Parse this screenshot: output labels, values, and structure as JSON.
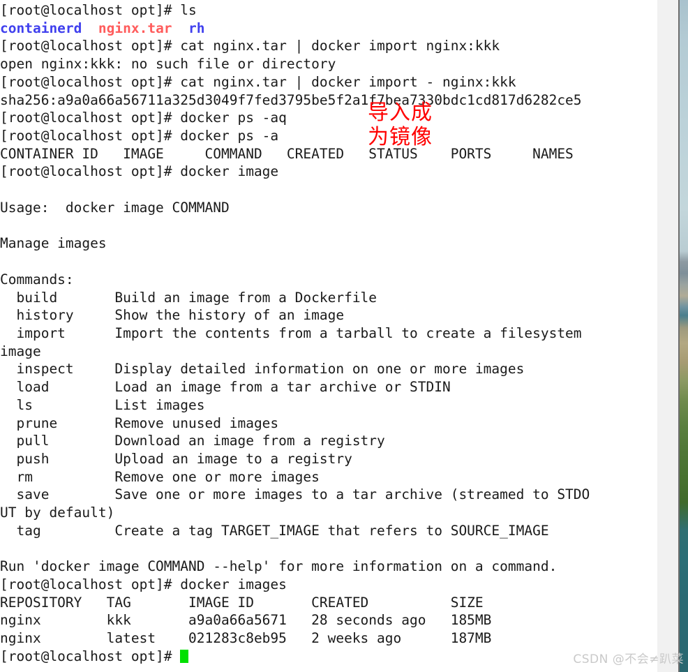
{
  "window": {
    "title": "root@localhost:/opt terminal",
    "prompt": "[root@localhost opt]#"
  },
  "terminal": {
    "font_color": "#1a1a1a",
    "background": "#ffffff",
    "cursor_color": "#00e000",
    "dir_color": "#4040ee",
    "archive_color": "#ff5c5c",
    "lines": [
      {
        "id": "l01",
        "type": "prompt",
        "prompt": "[root@localhost opt]# ",
        "command": "ls"
      },
      {
        "id": "l02",
        "type": "ls-out",
        "segments": [
          {
            "text": "containerd",
            "color": "blue"
          },
          {
            "text": "  ",
            "color": "normal"
          },
          {
            "text": "nginx.tar",
            "color": "red"
          },
          {
            "text": "  ",
            "color": "normal"
          },
          {
            "text": "rh",
            "color": "blue"
          }
        ]
      },
      {
        "id": "l03",
        "type": "prompt",
        "prompt": "[root@localhost opt]# ",
        "command": "cat nginx.tar | docker import nginx:kkk"
      },
      {
        "id": "l04",
        "type": "output",
        "text": "open nginx:kkk: no such file or directory"
      },
      {
        "id": "l05",
        "type": "prompt",
        "prompt": "[root@localhost opt]# ",
        "command": "cat nginx.tar | docker import - nginx:kkk"
      },
      {
        "id": "l06",
        "type": "output",
        "text": "sha256:a9a0a66a56711a325d3049f7fed3795be5f2a1f7bea7330bdc1cd817d6282ce5"
      },
      {
        "id": "l07",
        "type": "prompt",
        "prompt": "[root@localhost opt]# ",
        "command": "docker ps -aq"
      },
      {
        "id": "l08",
        "type": "prompt",
        "prompt": "[root@localhost opt]# ",
        "command": "docker ps -a"
      },
      {
        "id": "l09",
        "type": "output",
        "text": "CONTAINER ID   IMAGE     COMMAND   CREATED   STATUS    PORTS     NAMES"
      },
      {
        "id": "l10",
        "type": "prompt",
        "prompt": "[root@localhost opt]# ",
        "command": "docker image"
      },
      {
        "id": "l11",
        "type": "output",
        "text": ""
      },
      {
        "id": "l12",
        "type": "output",
        "text": "Usage:  docker image COMMAND"
      },
      {
        "id": "l13",
        "type": "output",
        "text": ""
      },
      {
        "id": "l14",
        "type": "output",
        "text": "Manage images"
      },
      {
        "id": "l15",
        "type": "output",
        "text": ""
      },
      {
        "id": "l16",
        "type": "output",
        "text": "Commands:"
      },
      {
        "id": "l17",
        "type": "output",
        "text": "  build       Build an image from a Dockerfile"
      },
      {
        "id": "l18",
        "type": "output",
        "text": "  history     Show the history of an image"
      },
      {
        "id": "l19",
        "type": "output",
        "text": "  import      Import the contents from a tarball to create a filesystem"
      },
      {
        "id": "l20",
        "type": "output",
        "text": "image"
      },
      {
        "id": "l21",
        "type": "output",
        "text": "  inspect     Display detailed information on one or more images"
      },
      {
        "id": "l22",
        "type": "output",
        "text": "  load        Load an image from a tar archive or STDIN"
      },
      {
        "id": "l23",
        "type": "output",
        "text": "  ls          List images"
      },
      {
        "id": "l24",
        "type": "output",
        "text": "  prune       Remove unused images"
      },
      {
        "id": "l25",
        "type": "output",
        "text": "  pull        Download an image from a registry"
      },
      {
        "id": "l26",
        "type": "output",
        "text": "  push        Upload an image to a registry"
      },
      {
        "id": "l27",
        "type": "output",
        "text": "  rm          Remove one or more images"
      },
      {
        "id": "l28",
        "type": "output",
        "text": "  save        Save one or more images to a tar archive (streamed to STDO"
      },
      {
        "id": "l29",
        "type": "output",
        "text": "UT by default)"
      },
      {
        "id": "l30",
        "type": "output",
        "text": "  tag         Create a tag TARGET_IMAGE that refers to SOURCE_IMAGE"
      },
      {
        "id": "l31",
        "type": "output",
        "text": ""
      },
      {
        "id": "l32",
        "type": "output",
        "text": "Run 'docker image COMMAND --help' for more information on a command."
      },
      {
        "id": "l33",
        "type": "prompt",
        "prompt": "[root@localhost opt]# ",
        "command": "docker images"
      },
      {
        "id": "l34",
        "type": "output",
        "text": "REPOSITORY   TAG       IMAGE ID       CREATED          SIZE"
      },
      {
        "id": "l35",
        "type": "output",
        "text": "nginx        kkk       a9a0a66a5671   28 seconds ago   185MB"
      },
      {
        "id": "l36",
        "type": "output",
        "text": "nginx        latest    021283c8eb95   2 weeks ago      187MB"
      },
      {
        "id": "l37",
        "type": "prompt-cursor",
        "prompt": "[root@localhost opt]# ",
        "command": ""
      }
    ]
  },
  "docker_image_help": {
    "usage": "docker image COMMAND",
    "description": "Manage images",
    "commands": [
      {
        "name": "build",
        "desc": "Build an image from a Dockerfile"
      },
      {
        "name": "history",
        "desc": "Show the history of an image"
      },
      {
        "name": "import",
        "desc": "Import the contents from a tarball to create a filesystem image"
      },
      {
        "name": "inspect",
        "desc": "Display detailed information on one or more images"
      },
      {
        "name": "load",
        "desc": "Load an image from a tar archive or STDIN"
      },
      {
        "name": "ls",
        "desc": "List images"
      },
      {
        "name": "prune",
        "desc": "Remove unused images"
      },
      {
        "name": "pull",
        "desc": "Download an image from a registry"
      },
      {
        "name": "push",
        "desc": "Upload an image to a registry"
      },
      {
        "name": "rm",
        "desc": "Remove one or more images"
      },
      {
        "name": "save",
        "desc": "Save one or more images to a tar archive (streamed to STDOUT by default)"
      },
      {
        "name": "tag",
        "desc": "Create a tag TARGET_IMAGE that refers to SOURCE_IMAGE"
      }
    ],
    "footer": "Run 'docker image COMMAND --help' for more information on a command."
  },
  "docker_ps_table": {
    "headers": [
      "CONTAINER ID",
      "IMAGE",
      "COMMAND",
      "CREATED",
      "STATUS",
      "PORTS",
      "NAMES"
    ],
    "rows": []
  },
  "docker_images_table": {
    "headers": [
      "REPOSITORY",
      "TAG",
      "IMAGE ID",
      "CREATED",
      "SIZE"
    ],
    "rows": [
      [
        "nginx",
        "kkk",
        "a9a0a66a5671",
        "28 seconds ago",
        "185MB"
      ],
      [
        "nginx",
        "latest",
        "021283c8eb95",
        "2 weeks ago",
        "187MB"
      ]
    ]
  },
  "ls_listing": {
    "entries": [
      {
        "name": "containerd",
        "kind": "directory"
      },
      {
        "name": "nginx.tar",
        "kind": "archive"
      },
      {
        "name": "rh",
        "kind": "directory"
      }
    ]
  },
  "annotations": {
    "color": "#ff0000",
    "highlight_nginx_tar": "nginx.tar",
    "highlight_nginx_kkk": "nginx kkk",
    "note_line1": "导入成",
    "note_line2": "为镜像",
    "note_full": "导入成为镜像"
  },
  "watermark": {
    "text": "CSDN @不会≠趴菜",
    "color": "#c9c9c9"
  },
  "scrollbar": {
    "orientation": "vertical",
    "track_color": "#f1f1f1",
    "thumb_color": "#888888"
  }
}
